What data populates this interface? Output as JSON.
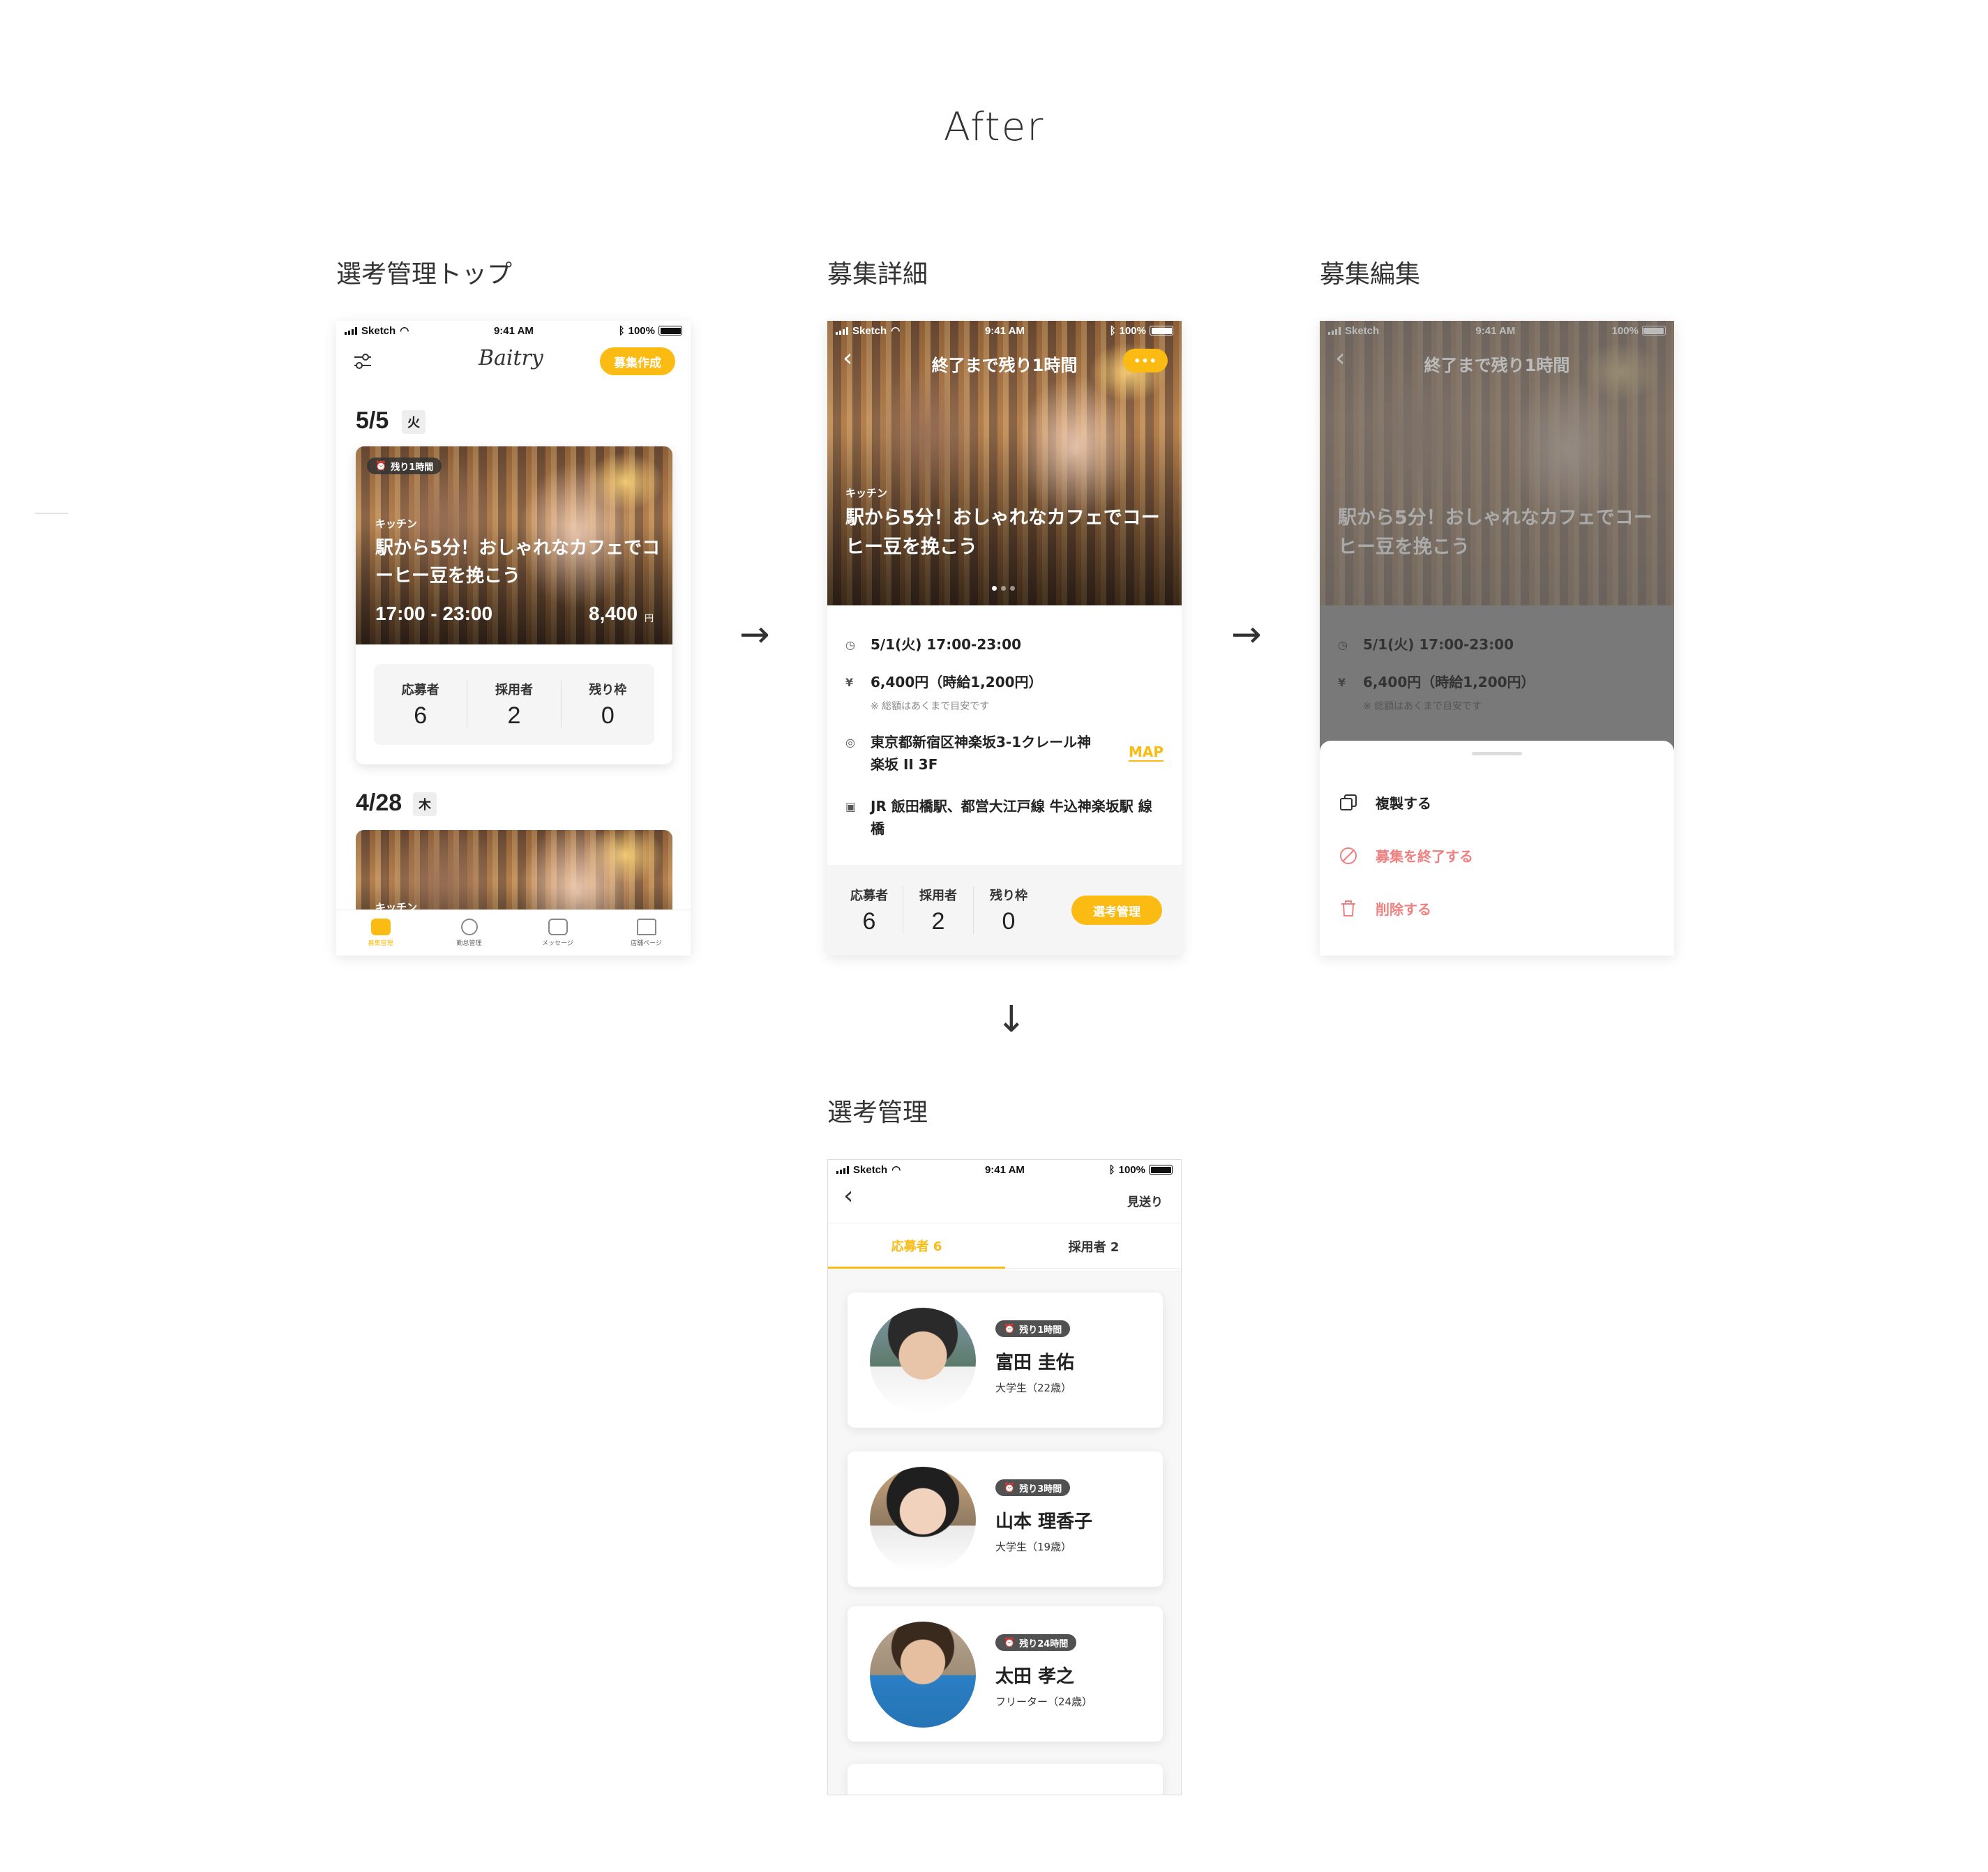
{
  "page": {
    "title": "After"
  },
  "sections": {
    "top": "選考管理トップ",
    "detail": "募集詳細",
    "edit": "募集編集",
    "manage": "選考管理"
  },
  "arrows": {
    "right": "→",
    "down": "↓"
  },
  "status_bar": {
    "carrier": "Sketch",
    "time": "9:41 AM",
    "battery": "100%"
  },
  "screen_top": {
    "logo": "Baitry",
    "create_button": "募集作成",
    "filter_icon": "filter-icon",
    "groups": [
      {
        "date": "5/5",
        "weekday": "火",
        "card": {
          "time_left": "残り1時間",
          "category": "キッチン",
          "title": "駅から5分！おしゃれなカフェでコーヒー豆を挽こう",
          "hours": "17:00 - 23:00",
          "pay": "8,400",
          "pay_unit": "円",
          "stats": [
            {
              "label": "応募者",
              "value": "6"
            },
            {
              "label": "採用者",
              "value": "2"
            },
            {
              "label": "残り枠",
              "value": "0"
            }
          ]
        }
      },
      {
        "date": "4/28",
        "weekday": "木",
        "card": {
          "category": "キッチン"
        }
      }
    ],
    "tabs": [
      {
        "label": "募集管理",
        "icon": "recruit-icon",
        "active": true
      },
      {
        "label": "勤怠管理",
        "icon": "attendance-icon",
        "active": false
      },
      {
        "label": "メッセージ",
        "icon": "message-icon",
        "active": false
      },
      {
        "label": "店舗ページ",
        "icon": "shop-icon",
        "active": false
      }
    ]
  },
  "screen_detail": {
    "header_title": "終了まで残り1時間",
    "more_button": "•••",
    "category": "キッチン",
    "title": "駅から5分！おしゃれなカフェでコーヒー豆を挽こう",
    "datetime": "5/1(火) 17:00-23:00",
    "pay": "6,400円（時給1,200円）",
    "pay_note": "※ 総額はあくまで目安です",
    "address": "東京都新宿区神楽坂3-1クレール神楽坂 II 3F",
    "map_link": "MAP",
    "stations": "JR 飯田橋駅、都営大江戸線 牛込神楽坂駅 線橋",
    "stats": [
      {
        "label": "応募者",
        "value": "6"
      },
      {
        "label": "採用者",
        "value": "2"
      },
      {
        "label": "残り枠",
        "value": "0"
      }
    ],
    "manage_button": "選考管理"
  },
  "screen_edit": {
    "header_title": "終了まで残り1時間",
    "actions": [
      {
        "label": "複製する",
        "icon": "copy-icon",
        "color": "#222222"
      },
      {
        "label": "募集を終了する",
        "icon": "prohibit-icon",
        "color": "#F08080"
      },
      {
        "label": "削除する",
        "icon": "trash-icon",
        "color": "#F08080"
      }
    ]
  },
  "screen_manage": {
    "back": "‹",
    "skip": "見送り",
    "tabs": [
      {
        "label": "応募者 6",
        "active": true
      },
      {
        "label": "採用者 2",
        "active": false
      }
    ],
    "candidates": [
      {
        "time_left": "残り1時間",
        "name": "富田 圭佑",
        "info": "大学生（22歳）"
      },
      {
        "time_left": "残り3時間",
        "name": "山本 理香子",
        "info": "大学生（19歳）"
      },
      {
        "time_left": "残り24時間",
        "name": "太田 孝之",
        "info": "フリーター（24歳）"
      }
    ]
  },
  "colors": {
    "accent": "#FBBB12",
    "danger": "#F08080",
    "text": "#222222"
  }
}
